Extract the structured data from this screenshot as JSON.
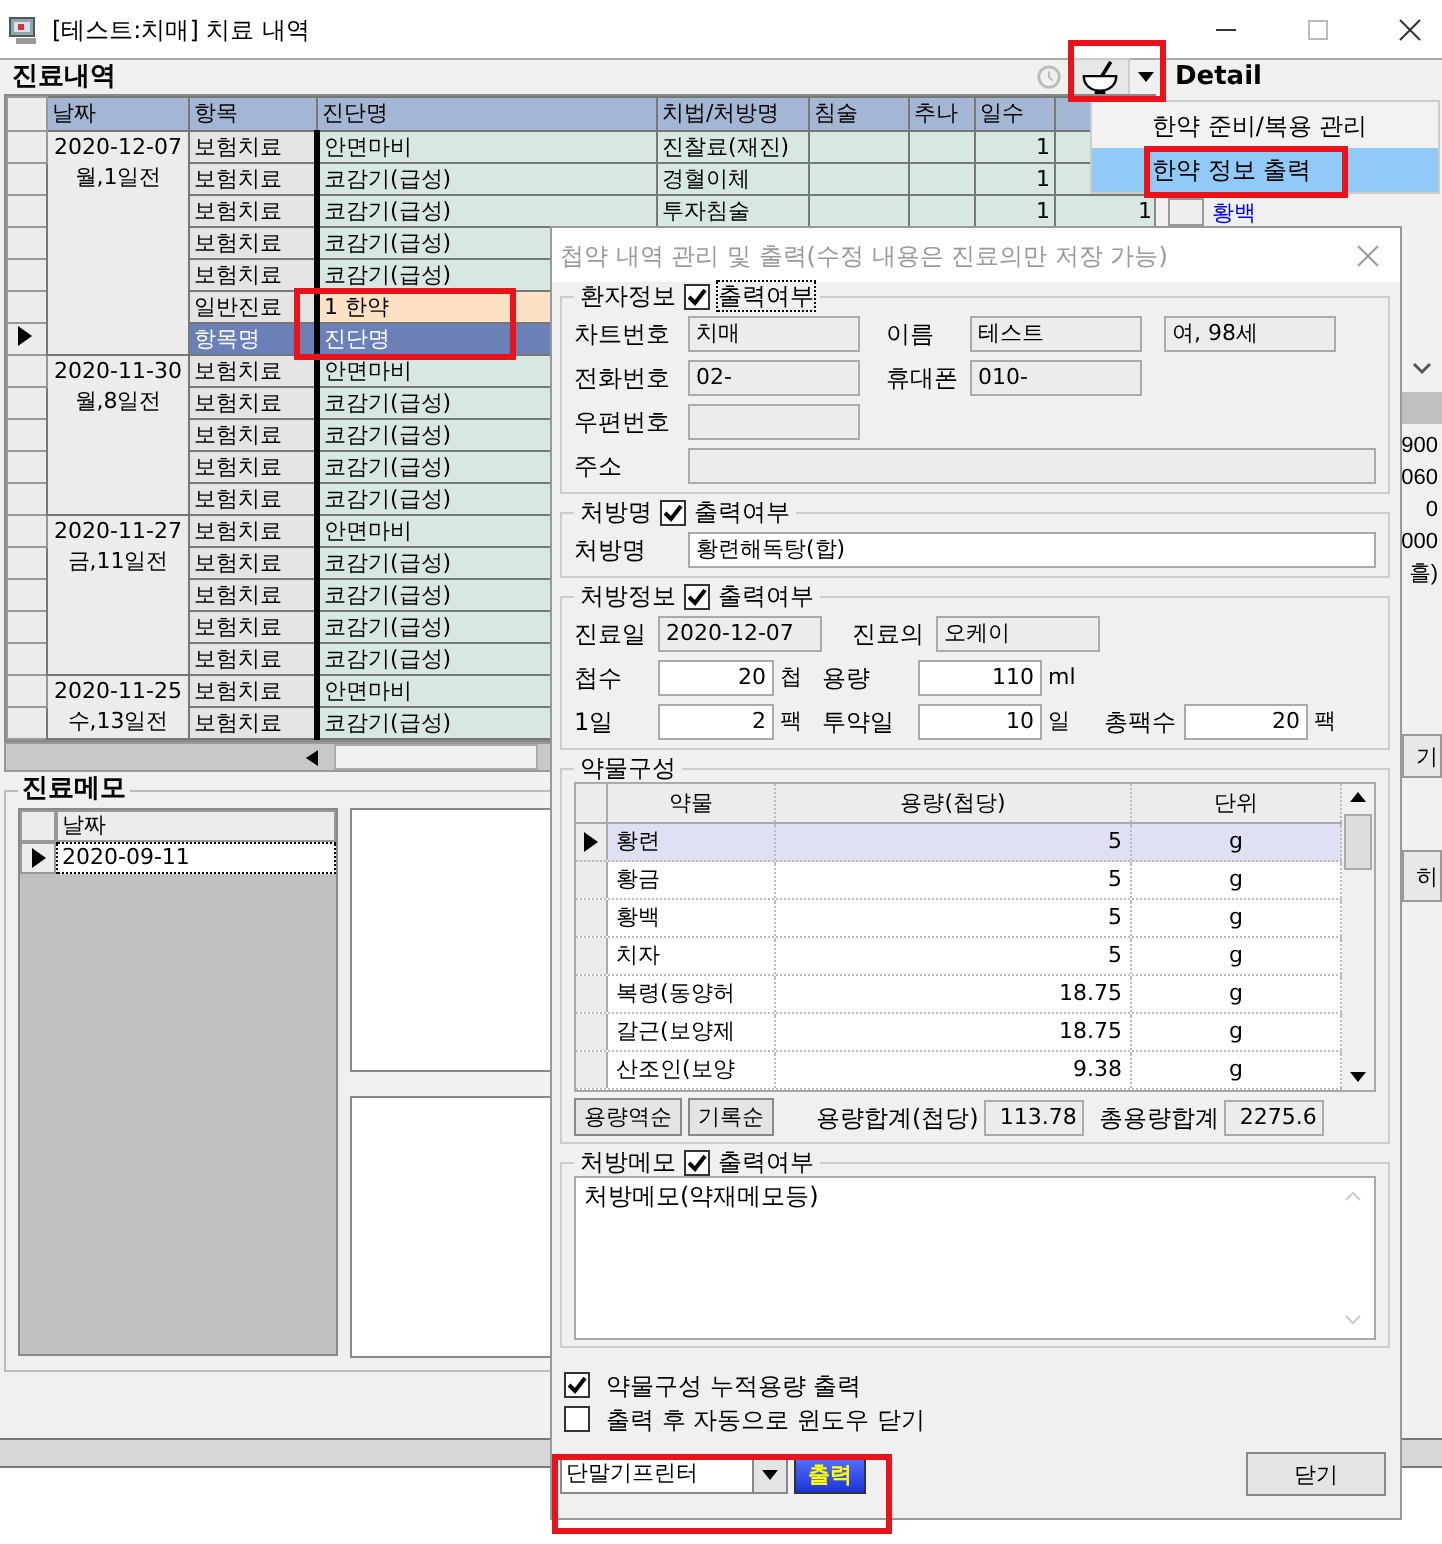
{
  "window": {
    "title": "[테스트:치매] 치료 내역"
  },
  "header": {
    "title": "진료내역",
    "detail": "Detail"
  },
  "tool_menu": {
    "items": [
      {
        "label": "한약 준비/복용 관리",
        "selected": false
      },
      {
        "label": "한약 정보 출력",
        "selected": true
      }
    ]
  },
  "treatment_table": {
    "columns": [
      "날짜",
      "항목",
      "진단명",
      "치법/처방명",
      "침술",
      "추나",
      "일수"
    ],
    "groups": [
      {
        "date": "2020-12-07",
        "ago": "월,1일전",
        "rows": [
          {
            "item": "보험치료",
            "diagnosis": "안면마비",
            "treatment": "진찰료(재진)",
            "days": "1",
            "selected": false,
            "kind": "normal"
          },
          {
            "item": "보험치료",
            "diagnosis": "코감기(급성)",
            "treatment": "경혈이체",
            "days": "1",
            "selected": false,
            "kind": "normal"
          },
          {
            "item": "보험치료",
            "diagnosis": "코감기(급성)",
            "treatment": "투자침술",
            "days": "1",
            "extra": "1",
            "selected": false,
            "kind": "normal"
          },
          {
            "item": "보험치료",
            "diagnosis": "코감기(급성)",
            "selected": false,
            "kind": "normal"
          },
          {
            "item": "보험치료",
            "diagnosis": "코감기(급성)",
            "selected": false,
            "kind": "normal"
          },
          {
            "item": "일반진료",
            "diagnosis": "1 한약",
            "selected": false,
            "kind": "herbal"
          },
          {
            "item": "항목명",
            "diagnosis": "진단명",
            "selected": true,
            "kind": "normal"
          }
        ]
      },
      {
        "date": "2020-11-30",
        "ago": "월,8일전",
        "rows": [
          {
            "item": "보험치료",
            "diagnosis": "안면마비",
            "selected": false,
            "kind": "normal"
          },
          {
            "item": "보험치료",
            "diagnosis": "코감기(급성)",
            "selected": false,
            "kind": "normal"
          },
          {
            "item": "보험치료",
            "diagnosis": "코감기(급성)",
            "selected": false,
            "kind": "normal"
          },
          {
            "item": "보험치료",
            "diagnosis": "코감기(급성)",
            "selected": false,
            "kind": "normal"
          },
          {
            "item": "보험치료",
            "diagnosis": "코감기(급성)",
            "selected": false,
            "kind": "normal"
          }
        ]
      },
      {
        "date": "2020-11-27",
        "ago": "금,11일전",
        "rows": [
          {
            "item": "보험치료",
            "diagnosis": "안면마비",
            "selected": false,
            "kind": "normal"
          },
          {
            "item": "보험치료",
            "diagnosis": "코감기(급성)",
            "selected": false,
            "kind": "normal"
          },
          {
            "item": "보험치료",
            "diagnosis": "코감기(급성)",
            "selected": false,
            "kind": "normal"
          },
          {
            "item": "보험치료",
            "diagnosis": "코감기(급성)",
            "selected": false,
            "kind": "normal"
          },
          {
            "item": "보험치료",
            "diagnosis": "코감기(급성)",
            "selected": false,
            "kind": "normal"
          }
        ]
      },
      {
        "date": "2020-11-25",
        "ago": "수,13일전",
        "rows": [
          {
            "item": "보험치료",
            "diagnosis": "안면마비",
            "selected": false,
            "kind": "normal"
          },
          {
            "item": "보험치료",
            "diagnosis": "코감기(급성)",
            "selected": false,
            "kind": "normal"
          }
        ]
      }
    ]
  },
  "right_panel": {
    "text": "황백",
    "values": [
      "900",
      "060",
      "0",
      "000",
      "흘)"
    ],
    "buttons": [
      "기",
      "히"
    ]
  },
  "memo": {
    "title": "진료메모",
    "column": "날짜",
    "rows": [
      {
        "date": "2020-09-11",
        "selected": true
      }
    ]
  },
  "dialog": {
    "title": "첩약 내역 관리 및 출력(수정 내용은 진료의만 저장 가능)",
    "patient": {
      "label": "환자정보",
      "print": {
        "label": "출력여부",
        "checked": true
      },
      "chart_no": {
        "label": "차트번호",
        "value": "치매"
      },
      "name": {
        "label": "이름",
        "value": "테스트"
      },
      "sex_age": "여, 98세",
      "phone": {
        "label": "전화번호",
        "value": "02-"
      },
      "mobile": {
        "label": "휴대폰",
        "value": "010-"
      },
      "zip": {
        "label": "우편번호"
      },
      "address": {
        "label": "주소"
      }
    },
    "prescription_name": {
      "label": "처방명",
      "print": {
        "label": "출력여부",
        "checked": true
      },
      "field_label": "처방명",
      "value": "황련해독탕(합)"
    },
    "prescription_info": {
      "label": "처방정보",
      "print": {
        "label": "출력여부",
        "checked": true
      },
      "date": {
        "label": "진료일",
        "value": "2020-12-07"
      },
      "doctor": {
        "label": "진료의",
        "value": "오케이"
      },
      "doses": {
        "label": "첩수",
        "value": "20",
        "unit": "첩"
      },
      "volume": {
        "label": "용량",
        "value": "110",
        "unit": "ml"
      },
      "per_day": {
        "label": "1일",
        "value": "2",
        "unit": "팩"
      },
      "days": {
        "label": "투약일",
        "value": "10",
        "unit": "일"
      },
      "total_packs": {
        "label": "총팩수",
        "value": "20",
        "unit": "팩"
      }
    },
    "herbs": {
      "label": "약물구성",
      "columns": [
        "약물",
        "용량(첩당)",
        "단위"
      ],
      "rows": [
        {
          "name": "황련",
          "amount": "5",
          "unit": "g",
          "selected": true
        },
        {
          "name": "황금",
          "amount": "5",
          "unit": "g",
          "selected": false
        },
        {
          "name": "황백",
          "amount": "5",
          "unit": "g",
          "selected": false
        },
        {
          "name": "치자",
          "amount": "5",
          "unit": "g",
          "selected": false
        },
        {
          "name": "복령(동양허",
          "amount": "18.75",
          "unit": "g",
          "selected": false
        },
        {
          "name": "갈근(보양제",
          "amount": "18.75",
          "unit": "g",
          "selected": false
        },
        {
          "name": "산조인(보양",
          "amount": "9.38",
          "unit": "g",
          "selected": false
        }
      ],
      "buttons": [
        "용량역순",
        "기록순"
      ],
      "total_per_dose": {
        "label": "용량합계(첩당)",
        "value": "113.78"
      },
      "total": {
        "label": "총용량합계",
        "value": "2275.6"
      }
    },
    "memo": {
      "label": "처방메모",
      "print": {
        "label": "출력여부",
        "checked": true
      },
      "text": "처방메모(약재메모등)"
    },
    "options": [
      {
        "label": "약물구성 누적용량 출력",
        "checked": true
      },
      {
        "label": "출력 후 자동으로 윈도우 닫기",
        "checked": false
      }
    ],
    "printer": "단말기프린터",
    "print_button": "출력",
    "close_button": "닫기"
  }
}
